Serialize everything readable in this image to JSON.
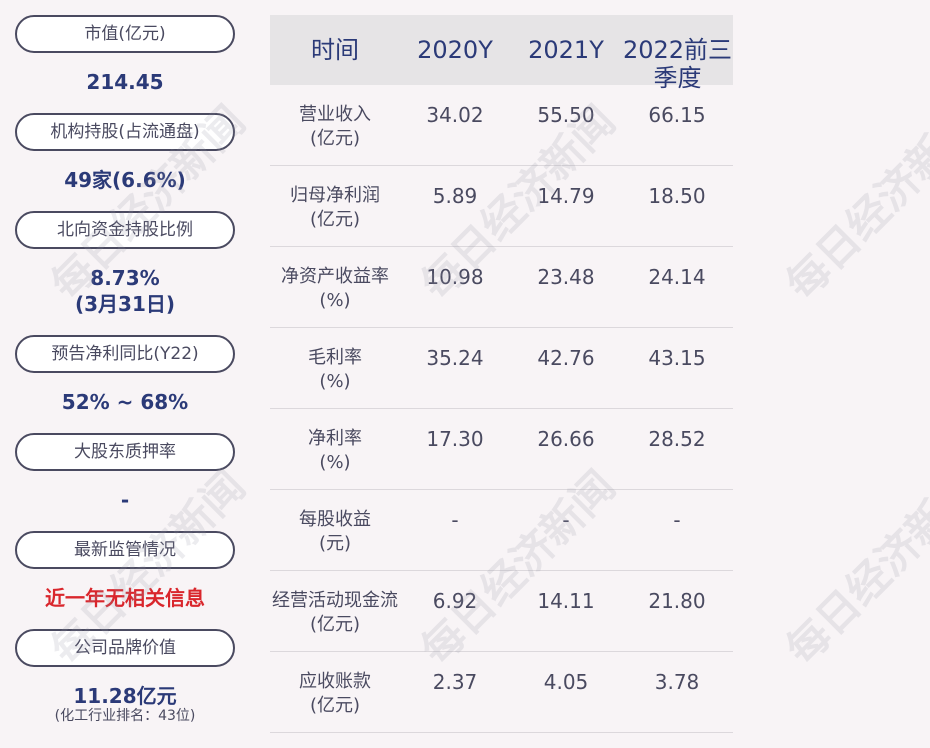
{
  "left_panel": {
    "items": [
      {
        "label": "市值(亿元)",
        "value": "214.45"
      },
      {
        "label": "机构持股(占流通盘)",
        "value": "49家(6.6%)"
      },
      {
        "label": "北向资金持股比例",
        "value": "8.73%",
        "value2": "(3月31日)"
      },
      {
        "label": "预告净利同比(Y22)",
        "value": "52% ~ 68%"
      },
      {
        "label": "大股东质押率",
        "value": "-"
      },
      {
        "label": "最新监管情况",
        "value": "近一年无相关信息",
        "value_color": "#d9262c"
      },
      {
        "label": "公司品牌价值",
        "value": "11.28亿元",
        "sub": "(化工行业排名：43位)"
      }
    ]
  },
  "table": {
    "headers": [
      "时间",
      "2020Y",
      "2021Y",
      "2022前三季度"
    ],
    "rows": [
      {
        "label": "营业收入",
        "unit": "(亿元)",
        "values": [
          "34.02",
          "55.50",
          "66.15"
        ]
      },
      {
        "label": "归母净利润",
        "unit": "(亿元)",
        "values": [
          "5.89",
          "14.79",
          "18.50"
        ]
      },
      {
        "label": "净资产收益率",
        "unit": "(%)",
        "values": [
          "10.98",
          "23.48",
          "24.14"
        ]
      },
      {
        "label": "毛利率",
        "unit": "(%)",
        "values": [
          "35.24",
          "42.76",
          "43.15"
        ]
      },
      {
        "label": "净利率",
        "unit": "(%)",
        "values": [
          "17.30",
          "26.66",
          "28.52"
        ]
      },
      {
        "label": "每股收益",
        "unit": "(元)",
        "values": [
          "-",
          "-",
          "-"
        ]
      },
      {
        "label": "经营活动现金流",
        "unit": "(亿元)",
        "values": [
          "6.92",
          "14.11",
          "21.80"
        ]
      },
      {
        "label": "应收账款",
        "unit": "(亿元)",
        "values": [
          "2.37",
          "4.05",
          "3.78"
        ]
      }
    ]
  },
  "watermark": "每日经济新闻"
}
